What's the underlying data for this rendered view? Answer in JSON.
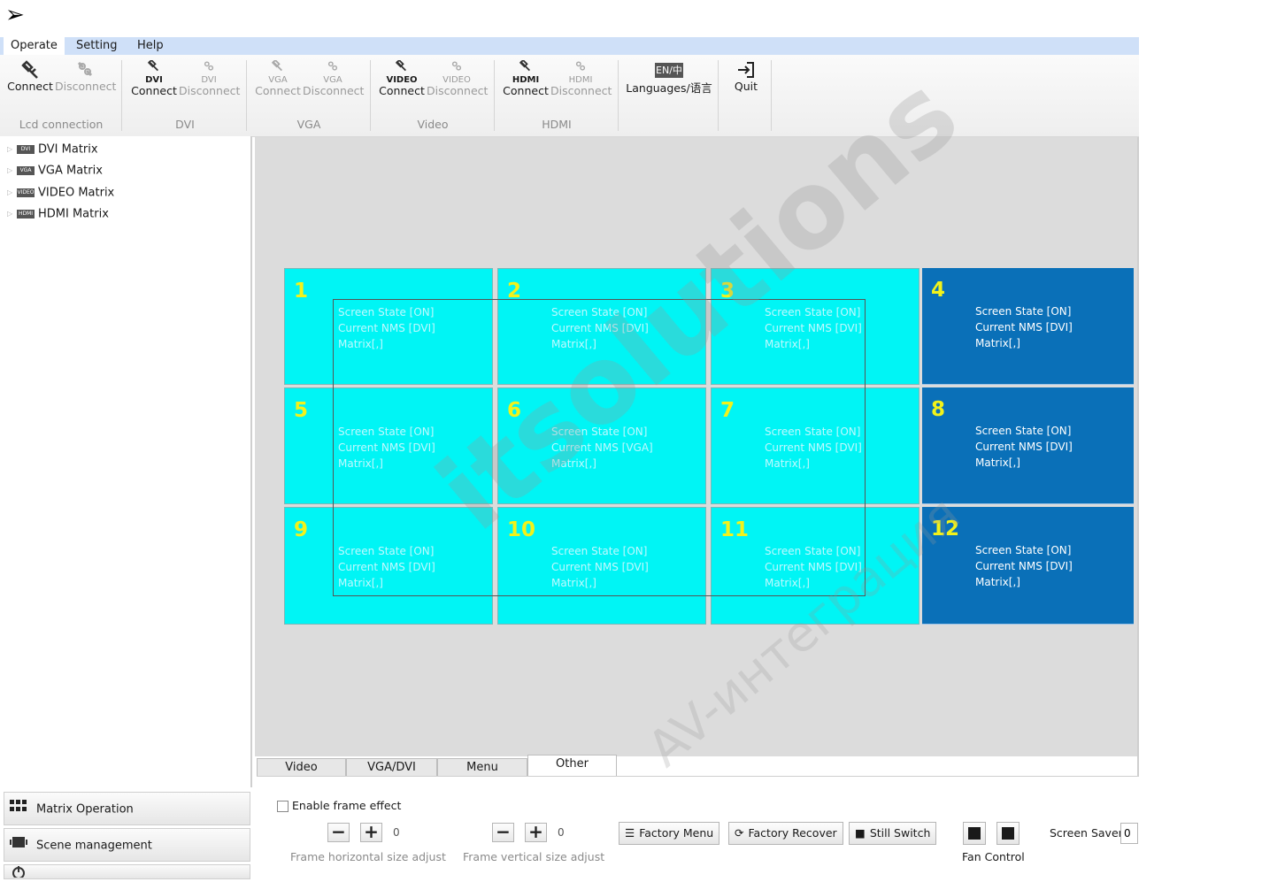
{
  "top_arrow": "➢",
  "menubar": {
    "items": [
      {
        "label": "Operate",
        "active": true
      },
      {
        "label": "Setting",
        "active": false
      },
      {
        "label": "Help",
        "active": false
      }
    ]
  },
  "ribbon": {
    "lcd": {
      "connect": "Connect",
      "disconnect": "Disconnect",
      "group": "Lcd connection"
    },
    "dvi": {
      "sub": "DVI",
      "connect": "Connect",
      "disconnect": "Disconnect",
      "group": "DVI"
    },
    "vga": {
      "sub": "VGA",
      "connect": "Connect",
      "disconnect": "Disconnect",
      "group": "VGA"
    },
    "video": {
      "sub": "VIDEO",
      "connect": "Connect",
      "disconnect": "Disconnect",
      "group": "Video"
    },
    "hdmi": {
      "sub": "HDMI",
      "connect": "Connect",
      "disconnect": "Disconnect",
      "group": "HDMI"
    },
    "languages": {
      "icon_text": "EN/中",
      "label": "Languages/语言"
    },
    "quit": {
      "label": "Quit"
    }
  },
  "tree": {
    "items": [
      {
        "tag": "DVI",
        "label": "DVI Matrix"
      },
      {
        "tag": "VGA",
        "label": "VGA Matrix"
      },
      {
        "tag": "VIDEO",
        "label": "VIDEO Matrix"
      },
      {
        "tag": "HDMI",
        "label": "HDMI Matrix"
      }
    ]
  },
  "nav": {
    "matrix_operation": "Matrix Operation",
    "scene_management": "Scene management"
  },
  "grid": {
    "cells": [
      {
        "num": "1",
        "state": "Screen State [ON]",
        "nms": "Current NMS [DVI]",
        "matrix": "Matrix[,]",
        "style": "cyan"
      },
      {
        "num": "2",
        "state": "Screen State [ON]",
        "nms": "Current NMS [DVI]",
        "matrix": "Matrix[,]",
        "style": "cyan"
      },
      {
        "num": "3",
        "state": "Screen State [ON]",
        "nms": "Current NMS [DVI]",
        "matrix": "Matrix[,]",
        "style": "cyan"
      },
      {
        "num": "4",
        "state": "Screen State [ON]",
        "nms": "Current NMS [DVI]",
        "matrix": "Matrix[,]",
        "style": "blue"
      },
      {
        "num": "5",
        "state": "Screen State [ON]",
        "nms": "Current NMS [DVI]",
        "matrix": "Matrix[,]",
        "style": "cyan"
      },
      {
        "num": "6",
        "state": "Screen State [ON]",
        "nms": "Current NMS [VGA]",
        "matrix": "Matrix[,]",
        "style": "cyan"
      },
      {
        "num": "7",
        "state": "Screen State [ON]",
        "nms": "Current NMS [DVI]",
        "matrix": "Matrix[,]",
        "style": "cyan"
      },
      {
        "num": "8",
        "state": "Screen State [ON]",
        "nms": "Current NMS [DVI]",
        "matrix": "Matrix[,]",
        "style": "blue"
      },
      {
        "num": "9",
        "state": "Screen State [ON]",
        "nms": "Current NMS [DVI]",
        "matrix": "Matrix[,]",
        "style": "cyan"
      },
      {
        "num": "10",
        "state": "Screen State [ON]",
        "nms": "Current NMS [DVI]",
        "matrix": "Matrix[,]",
        "style": "cyan"
      },
      {
        "num": "11",
        "state": "Screen State [ON]",
        "nms": "Current NMS [DVI]",
        "matrix": "Matrix[,]",
        "style": "cyan"
      },
      {
        "num": "12",
        "state": "Screen State [ON]",
        "nms": "Current NMS [DVI]",
        "matrix": "Matrix[,]",
        "style": "blue"
      }
    ]
  },
  "tabs": [
    {
      "label": "Video",
      "active": false
    },
    {
      "label": "VGA/DVI",
      "active": false
    },
    {
      "label": "Menu",
      "active": false
    },
    {
      "label": "Other",
      "active": true
    }
  ],
  "controls": {
    "enable_frame_effect": "Enable frame effect",
    "minus": "−",
    "plus": "+",
    "h_value": "0",
    "v_value": "0",
    "h_label": "Frame horizontal size adjust",
    "v_label": "Frame vertical size adjust",
    "factory_menu": "Factory Menu",
    "factory_recover": "Factory Recover",
    "still_switch": "Still Switch",
    "fan_control": "Fan Control",
    "screen_saver": "Screen Saver",
    "screen_saver_value": "0"
  },
  "watermark": {
    "main": "itsolutions",
    "sub": "AV-интеграция"
  },
  "colors": {
    "cell_cyan": "#00f5f5",
    "cell_blue": "#0a70b8",
    "cell_number": "#f2f21a",
    "menubar": "#cfe0f8"
  }
}
